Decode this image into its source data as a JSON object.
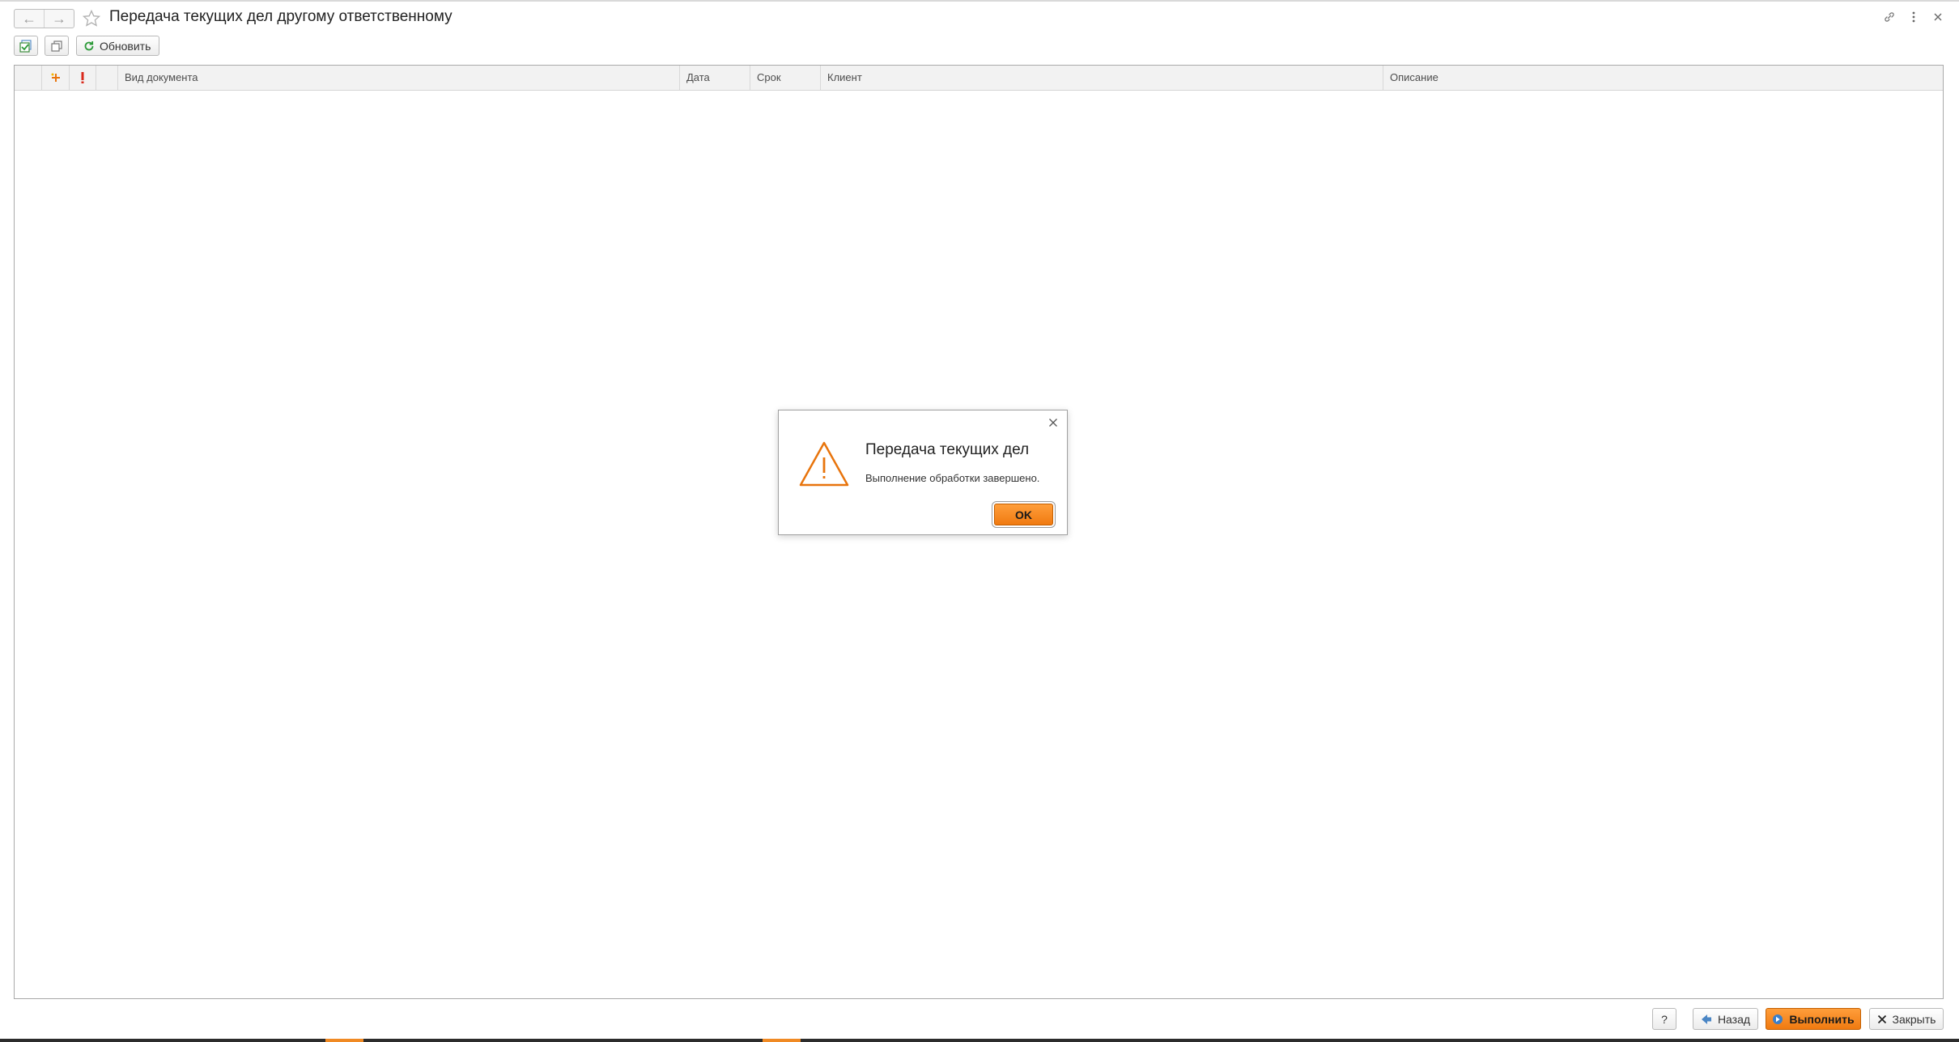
{
  "window": {
    "title": "Передача текущих дел другому ответственному"
  },
  "toolbar": {
    "refresh_label": "Обновить"
  },
  "table": {
    "columns": {
      "doc_type": "Вид документа",
      "date": "Дата",
      "deadline": "Срок",
      "client": "Клиент",
      "description": "Описание"
    },
    "rows": []
  },
  "dialog": {
    "title": "Передача текущих дел",
    "message": "Выполнение обработки завершено.",
    "ok_label": "OK"
  },
  "footer": {
    "help_label": "?",
    "back_label": "Назад",
    "execute_label": "Выполнить",
    "close_label": "Закрыть"
  },
  "colors": {
    "accent": "#f08a24",
    "warning": "#e8740c",
    "refresh_green": "#2e9b3a"
  }
}
